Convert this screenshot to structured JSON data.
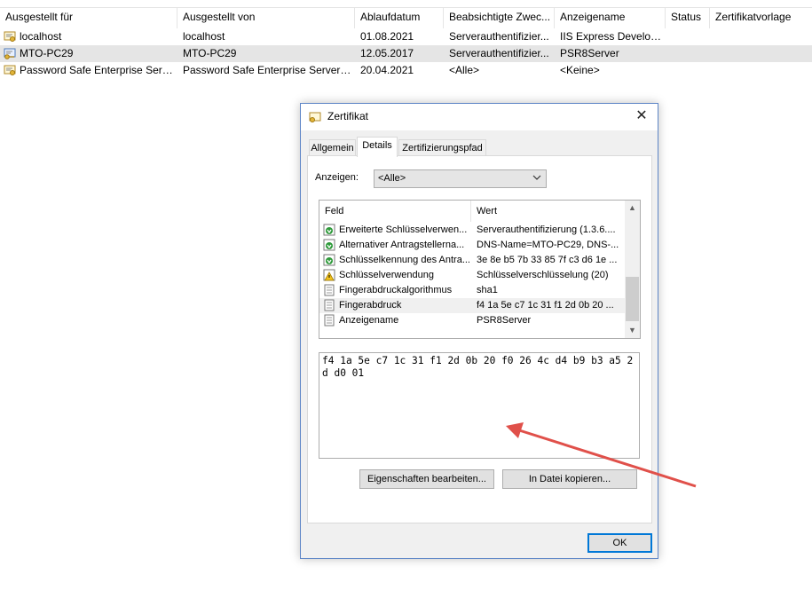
{
  "list": {
    "columns": [
      {
        "label": "Ausgestellt für"
      },
      {
        "label": "Ausgestellt von"
      },
      {
        "label": "Ablaufdatum"
      },
      {
        "label": "Beabsichtigte Zwec..."
      },
      {
        "label": "Anzeigename"
      },
      {
        "label": "Status"
      },
      {
        "label": "Zertifikatvorlage"
      }
    ],
    "sort_indicator": "^",
    "rows": [
      {
        "issued_to": "localhost",
        "issued_by": "localhost",
        "expires": "01.08.2021",
        "purpose": "Serverauthentifizier...",
        "friendly": "IIS Express Develop...",
        "icon": "certificate-icon"
      },
      {
        "issued_to": "MTO-PC29",
        "issued_by": "MTO-PC29",
        "expires": "12.05.2017",
        "purpose": "Serverauthentifizier...",
        "friendly": "PSR8Server",
        "icon": "certificate-key-icon"
      },
      {
        "issued_to": "Password Safe Enterprise Server...",
        "issued_by": "Password Safe Enterprise Server - ...",
        "expires": "20.04.2021",
        "purpose": "<Alle>",
        "friendly": "<Keine>",
        "icon": "certificate-icon"
      }
    ]
  },
  "dialog": {
    "title": "Zertifikat",
    "close_glyph": "✕",
    "tabs": [
      {
        "label": "Allgemein"
      },
      {
        "label": "Details"
      },
      {
        "label": "Zertifizierungspfad"
      }
    ],
    "show_label": "Anzeigen:",
    "show_value": "<Alle>",
    "field_header": "Feld",
    "value_header": "Wert",
    "fields": [
      {
        "name": "Erweiterte Schlüsselverwen...",
        "value": "Serverauthentifizierung (1.3.6....",
        "icon": "extension-icon"
      },
      {
        "name": "Alternativer Antragstellerna...",
        "value": "DNS-Name=MTO-PC29, DNS-...",
        "icon": "extension-icon"
      },
      {
        "name": "Schlüsselkennung des Antra...",
        "value": "3e 8e b5 7b 33 85 7f c3 d6 1e ...",
        "icon": "extension-icon"
      },
      {
        "name": "Schlüsselverwendung",
        "value": "Schlüsselverschlüsselung (20)",
        "icon": "warning-icon"
      },
      {
        "name": "Fingerabdruckalgorithmus",
        "value": "sha1",
        "icon": "document-icon"
      },
      {
        "name": "Fingerabdruck",
        "value": "f4 1a 5e c7 1c 31 f1 2d 0b 20 ...",
        "icon": "document-icon"
      },
      {
        "name": "Anzeigename",
        "value": "PSR8Server",
        "icon": "document-icon"
      }
    ],
    "hex_value": "f4 1a 5e c7 1c 31 f1 2d 0b 20 f0 26 4c d4 b9 b3 a5 2d d0 01",
    "edit_button": "Eigenschaften bearbeiten...",
    "copy_button": "In Datei kopieren...",
    "ok_button": "OK"
  },
  "colors": {
    "dialog_border": "#5e86c7",
    "ok_border": "#0078d7",
    "annotation_arrow": "#e0504a"
  }
}
